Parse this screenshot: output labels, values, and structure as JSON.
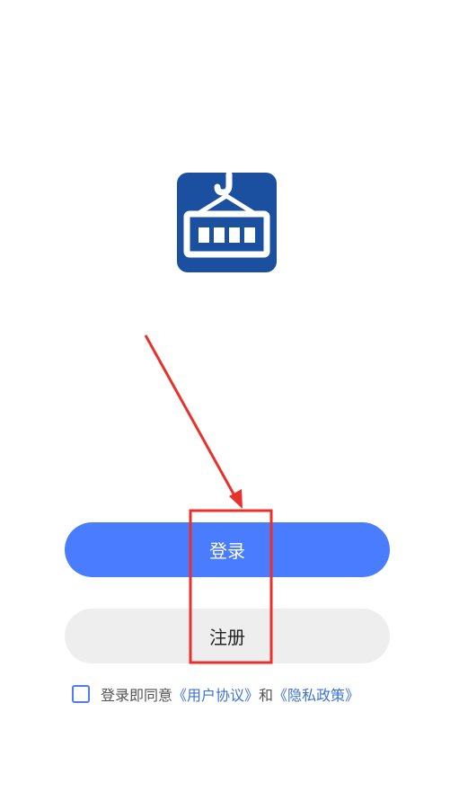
{
  "logo": {
    "icon": "crane-container-icon",
    "color": "#1b4fa0"
  },
  "buttons": {
    "login_label": "登录",
    "register_label": "注册"
  },
  "agreement": {
    "prefix": "登录即同意",
    "user_agreement": "《用户协议》",
    "conjunction": "和",
    "privacy_policy": "《隐私政策》",
    "checked": false
  },
  "annotation": {
    "color": "#e8312b"
  },
  "colors": {
    "primary": "#4a7cff",
    "secondary_button": "#eeeeee",
    "link": "#3b73d6"
  }
}
